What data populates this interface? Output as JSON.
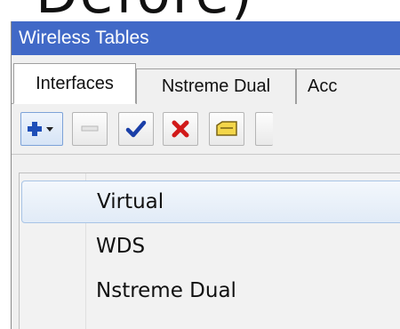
{
  "header_fragment": "Defore)",
  "window": {
    "title": "Wireless Tables"
  },
  "tabs": [
    {
      "label": "Interfaces"
    },
    {
      "label": "Nstreme Dual"
    },
    {
      "label": "Acc"
    }
  ],
  "toolbar": {
    "buttons": [
      {
        "icon": "add-icon"
      },
      {
        "icon": "remove-icon"
      },
      {
        "icon": "enable-check-icon"
      },
      {
        "icon": "disable-x-icon"
      },
      {
        "icon": "comment-note-icon"
      }
    ]
  },
  "add_menu": {
    "items": [
      {
        "label": "Virtual"
      },
      {
        "label": "WDS"
      },
      {
        "label": "Nstreme Dual"
      }
    ]
  },
  "colors": {
    "title_bar": "#4169c7",
    "add_icon": "#1f4fb8",
    "check_icon": "#1a3fa8",
    "x_icon": "#d11a1a",
    "note_icon": "#f3d64a"
  }
}
